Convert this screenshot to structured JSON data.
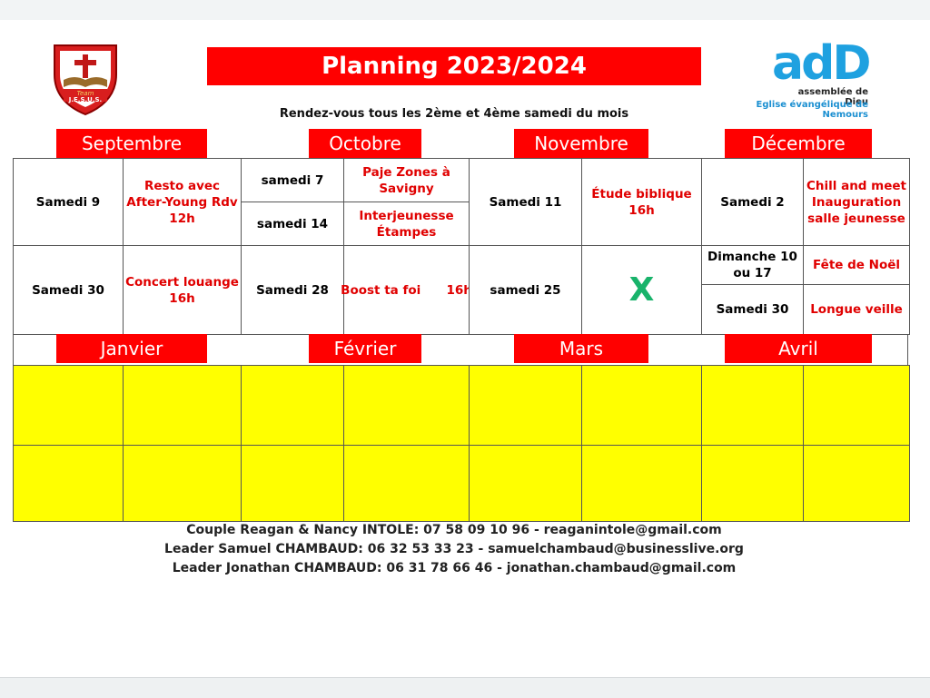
{
  "header": {
    "title": "Planning 2023/2024",
    "subtitle": "Rendez-vous tous les 2ème et 4ème samedi du mois",
    "logo_left_text": "Team J.E.S.U.S.",
    "logo_right_main": "adD",
    "logo_right_line1": "assemblée de Dieu",
    "logo_right_line2": "Eglise évangélique de Nemours"
  },
  "months_top": [
    "Septembre",
    "Octobre",
    "Novembre",
    "Décembre"
  ],
  "months_bottom": [
    "Janvier",
    "Février",
    "Mars",
    "Avril"
  ],
  "schedule": {
    "sep": {
      "r1_date": "Samedi 9",
      "r1_event": "Resto avec After-Young Rdv 12h",
      "r2_date": "Samedi 30",
      "r2_event": "Concert louange 16h"
    },
    "oct": {
      "r1a_date": "samedi 7",
      "r1a_event": "Paje Zones à Savigny",
      "r1b_date": "samedi 14",
      "r1b_event": "Interjeunesse Étampes",
      "r2_date": "Samedi 28",
      "r2_event": "Boost ta foi      16h"
    },
    "nov": {
      "r1_date": "Samedi 11",
      "r1_event": "Étude biblique 16h",
      "r2_date": "samedi 25",
      "r2_event": "X"
    },
    "dec": {
      "r1_date": "Samedi 2",
      "r1_event": "Chill and meet Inauguration salle jeunesse",
      "r2a_date": "Dimanche 10 ou 17",
      "r2a_event": "Fête de Noël",
      "r2b_date": "Samedi 30",
      "r2b_event": "Longue veille"
    }
  },
  "contacts": [
    "Couple Reagan & Nancy INTOLE: 07 58 09 10 96  - reaganintole@gmail.com",
    "Leader  Samuel CHAMBAUD: 06 32 53 33 23 - samuelchambaud@businesslive.org",
    "Leader  Jonathan CHAMBAUD: 06 31 78 66 46 - jonathan.chambaud@gmail.com"
  ],
  "colors": {
    "accent_red": "#ff0000",
    "event_red": "#e00000",
    "empty_yellow": "#ffff00",
    "x_green": "#19b36b",
    "brand_blue": "#1fa1e0"
  }
}
